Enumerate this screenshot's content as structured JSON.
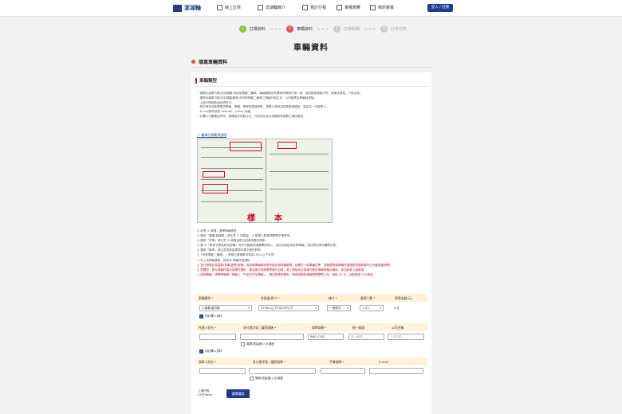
{
  "header": {
    "logo": "澎湖輪",
    "nav": [
      "線上訂票",
      "澎湖輪簡介",
      "預訂行程",
      "車輛規費",
      "我的車車"
    ],
    "login": "登入 / 註冊"
  },
  "steps": [
    {
      "num": "✓",
      "label": "訂購資料",
      "state": "done"
    },
    {
      "num": "2",
      "label": "車輛資料",
      "state": "cur"
    },
    {
      "num": "3",
      "label": "訂單明細",
      "state": "todo"
    },
    {
      "num": "4",
      "label": "訂單付款",
      "state": "todo"
    }
  ],
  "page_title": "車輛資料",
  "section_title": "填寫車輛資料",
  "card_title": "車輛類型",
  "notes": [
    "・請務必填寫行車(包含機車)或特型電動二輪車，車輛號碼及有關資料需與行照一致，若因填寫錯誤不符，將無法登船。(*為必填)",
    "・攜帶此機車汽車(包括電動機車)或特型電動二輪車之車輛行照正本，以供取票及登輪時查驗。",
    "・上述行照與各船班資料中。",
    "・如訂單完成後需更改車輛、車種、車牌填寫錯誤等，現場人員將為您更新與確認，並由另一位負責人。",
    "・E-mail請勿使用 hotmail、yahoo 信箱。",
    "・訂購人行動電話資訊，請確保可收取訂位、付款成功及出港通知等相關之通訊簡訊。"
  ],
  "sample_link": "機車行照範例說明",
  "sample_stamp": [
    "樣",
    "本"
  ],
  "rules": [
    {
      "text": "◎ 依照 ① 車種，選擇車輛類型。",
      "red": false
    },
    {
      "text": "◎ 類型「重機/普通車」請注意 ② 排氣量，③ 載運人數選項需擇正確費率。",
      "red": false
    },
    {
      "text": "◎ 類型「貨車」請注意 ④ 總重量是否超過承載的費率。",
      "red": false
    },
    {
      "text": "◎ 當 ⑤「車身式樣及附加配備」另外計價請詳細選擇後填入，未記月認定為特殊車輛，另計價比照特種車計費。",
      "red": false
    },
    {
      "text": "◎ 類型「機車」請注意排氣量選項勾選正確的費率。",
      "red": false
    },
    {
      "text": "◎「特型電動二輪車」：費用比照機車排氣量100cc以下計算。",
      "red": false
    },
    {
      "text": "◎ 非上述車輛類型，請參考 車輛托運須知",
      "red": false
    },
    {
      "text": "◎ 若行照登記為重車/貨車/遊覽/特種，為特殊車輛請詳閱計價比照特種車費，依屬於一般車輛訂票，須參閱特殊車輛托運規則或請致電本公司客服處詢問。",
      "red": true
    },
    {
      "text": "◎ 提醒您，部分車輛托運必須事先預約，報名當日依照車票發行自發，登上預船前必須事先登記車輛資格合格後，將加收車上保費用。",
      "red": true
    },
    {
      "text": "◎ 低碳車輛：請車牌號碼一律輸入「不含空白及橫線」，費用各車型類別，費用依照各車輛規費標準公告，適用 50 元，否則將依 6 元費用。",
      "red": true
    }
  ],
  "vehicle_form": {
    "headers": [
      "車輛類型 *",
      "排氣量/馬力 *",
      "樣式 *",
      "載運人數 *",
      "單價金額(元)"
    ],
    "type_value": "小客車/客貨車",
    "cc_value": "2799cc以下/301HP以下",
    "style_value": "一般樣式",
    "people_value": "1-5人",
    "price": "0 元",
    "same_buyer": "同訂購人資料"
  },
  "owner_form": {
    "headers": [
      "托運人姓名 *",
      "身分證字號 / 護照號碼 *",
      "車牌號碼 *",
      "統一編號",
      "公司名稱"
    ],
    "plate": "BNQ-7342",
    "tax_ph": "統一編號",
    "company_ph": "公司抬頭",
    "passport_chk": "護照/居留證/入出境證",
    "same_buyer": "同訂購人資料"
  },
  "driver_form": {
    "headers": [
      "駕車人姓名 *",
      "身分證字號 / 護照號碼 *",
      "手機號碼 *",
      "E-mail"
    ],
    "passport_chk": "護照/居留證/入出境證"
  },
  "upload": {
    "label": "上傳行照",
    "hint": "(小於5mb)",
    "button": "選擇檔案"
  }
}
